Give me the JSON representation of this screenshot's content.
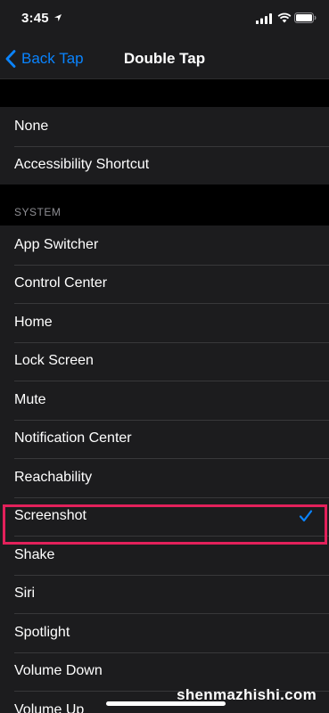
{
  "status": {
    "time": "3:45"
  },
  "nav": {
    "back_label": "Back Tap",
    "title": "Double Tap"
  },
  "top_group": {
    "items": [
      "None",
      "Accessibility Shortcut"
    ]
  },
  "system_section": {
    "header": "SYSTEM",
    "items": [
      "App Switcher",
      "Control Center",
      "Home",
      "Lock Screen",
      "Mute",
      "Notification Center",
      "Reachability",
      "Screenshot",
      "Shake",
      "Siri",
      "Spotlight",
      "Volume Down",
      "Volume Up"
    ],
    "selected": "Screenshot"
  },
  "watermark": "shenmazhishi.com",
  "colors": {
    "accent": "#0a84ff",
    "highlight": "#e3215b",
    "background": "#000000",
    "cell": "#1c1c1e"
  },
  "icons": [
    "location-arrow-icon",
    "cellular-signal-icon",
    "wifi-icon",
    "battery-icon",
    "chevron-left-icon",
    "checkmark-icon"
  ]
}
